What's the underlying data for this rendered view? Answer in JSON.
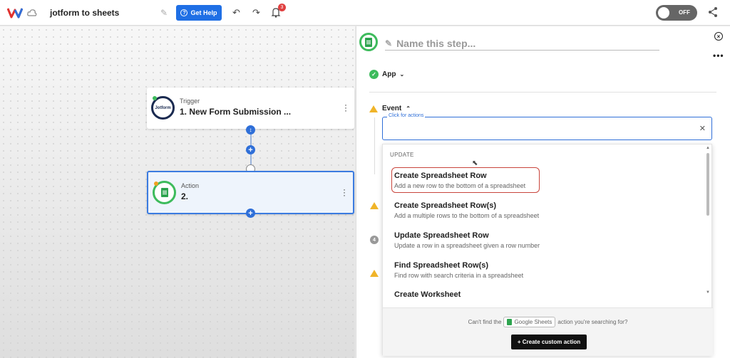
{
  "header": {
    "title": "jotform to sheets",
    "help_label": "Get Help",
    "notification_count": "3",
    "toggle_label": "OFF"
  },
  "canvas": {
    "trigger": {
      "type_label": "Trigger",
      "title": "1. New Form Submission ...",
      "logo_text": "Jotform"
    },
    "action": {
      "type_label": "Action",
      "title": "2."
    }
  },
  "panel": {
    "step_name_placeholder": "Name this step...",
    "app_label": "App",
    "event_label": "Event",
    "step_number": "4",
    "input_float_label": "Click for actions",
    "section_label": "UPDATE",
    "actions": [
      {
        "title": "Create Spreadsheet Row",
        "subtitle": "Add a new row to the bottom of a spreadsheet"
      },
      {
        "title": "Create Spreadsheet Row(s)",
        "subtitle": "Add a multiple rows to the bottom of a spreadsheet"
      },
      {
        "title": "Update Spreadsheet Row",
        "subtitle": "Update a row in a spreadsheet given a row number"
      },
      {
        "title": "Find Spreadsheet Row(s)",
        "subtitle": "Find row with search criteria in a spreadsheet"
      },
      {
        "title": "Create Worksheet",
        "subtitle": ""
      }
    ],
    "cant_find_prefix": "Can't find the",
    "app_chip": "Google Sheets",
    "cant_find_suffix": "action you're searching for?",
    "custom_action_label": "+ Create custom action"
  },
  "colors": {
    "accent": "#1f6fe5",
    "success": "#3dbb5c",
    "warning": "#f0b429",
    "highlight": "#c9453c"
  }
}
